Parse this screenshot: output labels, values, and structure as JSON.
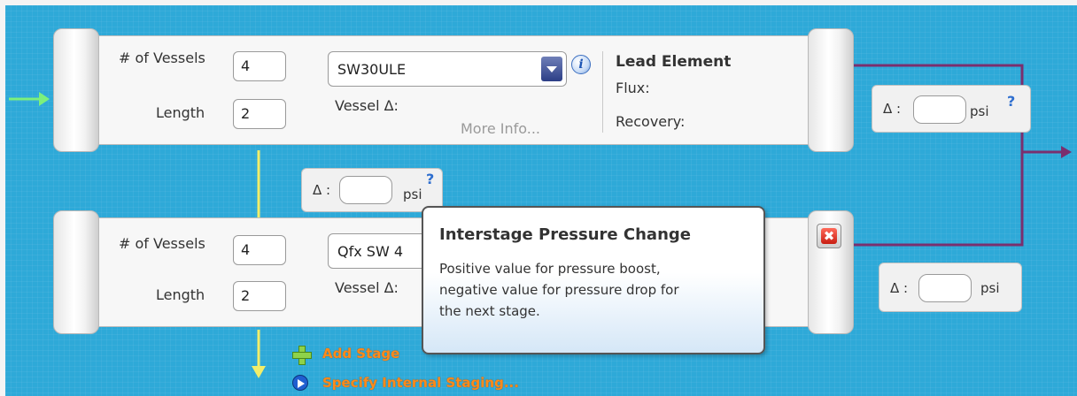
{
  "stage1": {
    "vessels_label": "# of Vessels",
    "vessels_value": "4",
    "length_label": "Length",
    "length_value": "2",
    "element_selected": "SW30ULE",
    "vessel_delta_label": "Vessel Δ:",
    "more_info_label": "More Info...",
    "lead_element_title": "Lead Element",
    "flux_label": "Flux:",
    "recovery_label": "Recovery:"
  },
  "stage2": {
    "vessels_label": "# of Vessels",
    "vessels_value": "4",
    "length_label": "Length",
    "length_value": "2",
    "element_selected": "Qfx SW 4",
    "vessel_delta_label": "Vessel Δ:"
  },
  "delta_boxes": {
    "concentrate_1": {
      "label": "Δ :",
      "value": "",
      "unit": "psi",
      "help": "?"
    },
    "interstage": {
      "label": "Δ :",
      "value": "",
      "unit": "psi",
      "help": "?"
    },
    "concentrate_2": {
      "label": "Δ :",
      "value": "",
      "unit": "psi"
    }
  },
  "tooltip": {
    "title": "Interstage Pressure Change",
    "lines": [
      "Positive value for pressure boost,",
      "negative value for pressure drop for",
      "the next stage."
    ]
  },
  "actions": {
    "add_stage": "Add Stage",
    "specify_internal_staging": "Specify Internal Staging..."
  },
  "colors": {
    "background": "#2ea9d8",
    "feed_arrow": "#7cf07c",
    "permeate_line": "#f2ee6a",
    "concentrate_line": "#7a2f6e",
    "action_text": "#ff8a1a"
  },
  "icons": {
    "info": "info-icon",
    "help": "help-icon",
    "remove": "remove-stage-icon",
    "add": "plus-icon",
    "link_arrow": "arrow-right-icon",
    "dropdown": "chevron-down-icon"
  }
}
